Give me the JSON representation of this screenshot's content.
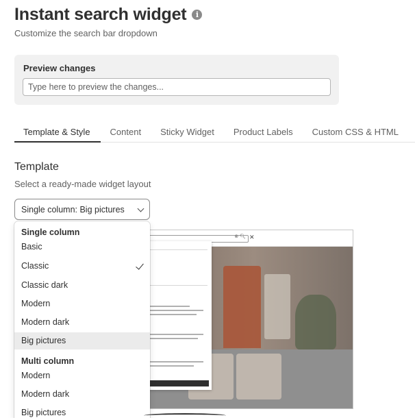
{
  "header": {
    "title": "Instant search widget",
    "subtitle": "Customize the search bar dropdown"
  },
  "preview": {
    "label": "Preview changes",
    "placeholder": "Type here to preview the changes..."
  },
  "tabs": [
    {
      "label": "Template & Style",
      "active": true
    },
    {
      "label": "Content"
    },
    {
      "label": "Sticky Widget"
    },
    {
      "label": "Product Labels"
    },
    {
      "label": "Custom CSS & HTML"
    }
  ],
  "template": {
    "title": "Template",
    "subtitle": "Select a ready-made widget layout",
    "selected_value": "Single column: Big pictures"
  },
  "dropdown": {
    "groups": [
      {
        "label": "Single column",
        "options": [
          "Basic",
          "Classic",
          "Classic dark",
          "Modern",
          "Modern dark",
          "Big pictures"
        ]
      },
      {
        "label": "Multi column",
        "options": [
          "Modern",
          "Modern dark",
          "Big pictures"
        ]
      }
    ],
    "checked": "Classic",
    "highlighted": "Big pictures"
  },
  "colors": {
    "accent": "#303030",
    "card_bg": "#f1f1f1",
    "highlight": "#ebebeb"
  },
  "icons": {
    "info": "info-icon",
    "select": "chevron-down-icon",
    "checked": "checkmark-icon"
  }
}
